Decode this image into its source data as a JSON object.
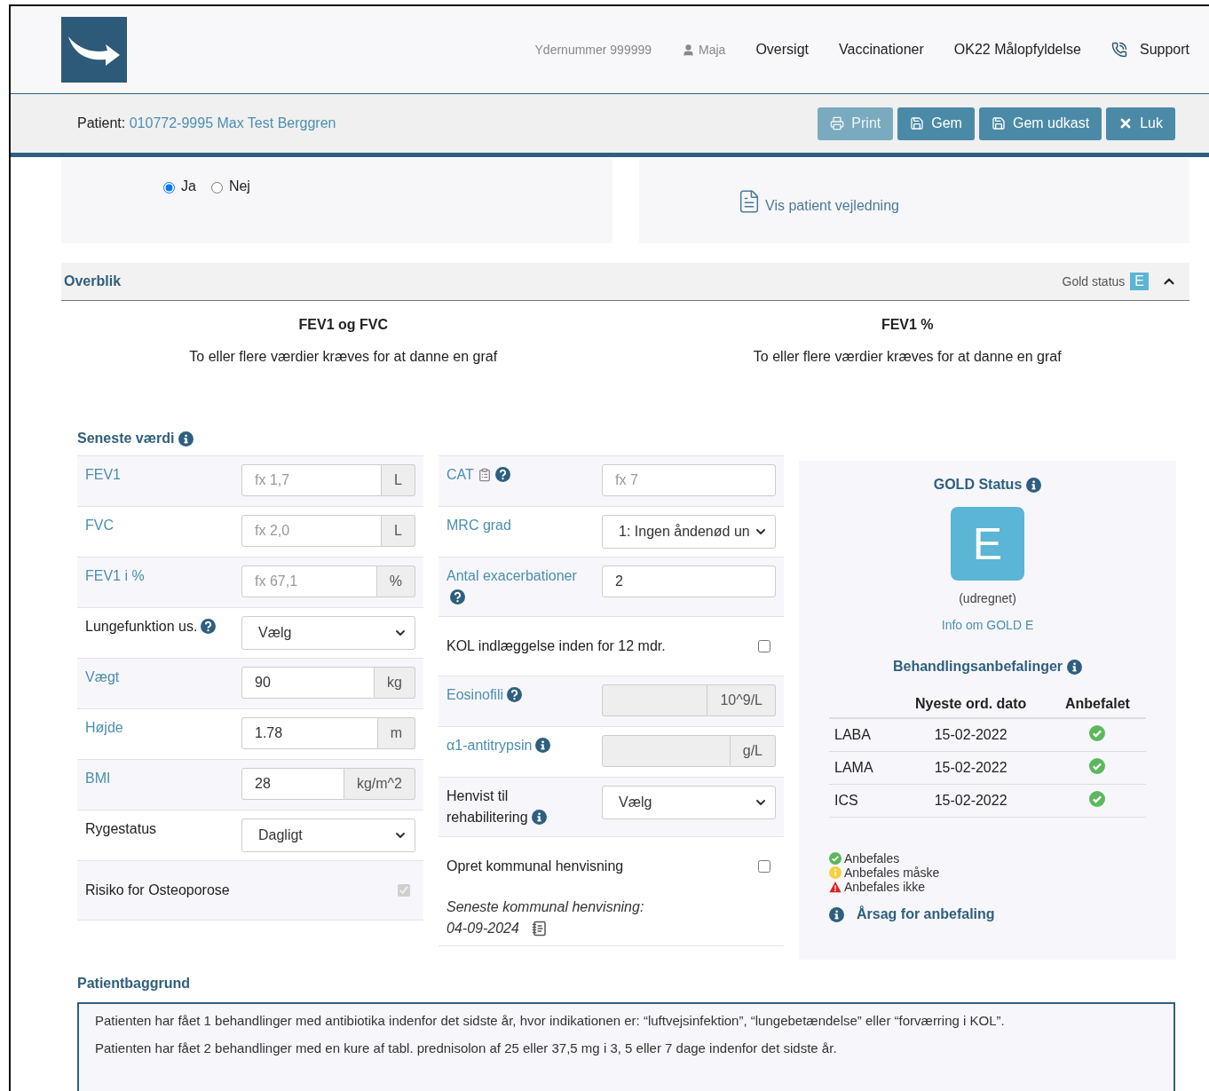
{
  "header": {
    "provider_number": "Ydernummer 999999",
    "user": "Maja",
    "nav": [
      {
        "label": "Oversigt",
        "kind": "link"
      },
      {
        "label": "Vaccinationer",
        "kind": "link"
      },
      {
        "label": "OK22 Målopfyldelse",
        "kind": "link"
      },
      {
        "label": "Support",
        "kind": "support"
      }
    ]
  },
  "patient_bar": {
    "label": "Patient:",
    "patient": "010772-9995 Max Test Berggren",
    "buttons": [
      {
        "label": "Print",
        "kind": "print",
        "disabled": true
      },
      {
        "label": "Gem",
        "kind": "save",
        "disabled": false
      },
      {
        "label": "Gem udkast",
        "kind": "save",
        "disabled": false
      },
      {
        "label": "Luk",
        "kind": "close",
        "disabled": false
      }
    ]
  },
  "consent": {
    "options": [
      {
        "label": "Ja",
        "selected": true
      },
      {
        "label": "Nej",
        "selected": false
      }
    ]
  },
  "guide_link": "Vis patient vejledning",
  "overview": {
    "title": "Overblik",
    "gold_label": "Gold status",
    "gold_value": "E",
    "expanded": true
  },
  "charts": [
    {
      "title": "FEV1 og FVC",
      "message": "To eller flere værdier kræves for at danne en graf"
    },
    {
      "title": "FEV1 %",
      "message": "To eller flere værdier kræves for at danne en graf"
    }
  ],
  "latest": {
    "title": "Seneste værdi",
    "columns": [
      [
        {
          "kind": "input",
          "label": "FEV1",
          "linked": true,
          "placeholder": "fx 1,7",
          "unit": "L",
          "disabled": false
        },
        {
          "kind": "input",
          "label": "FVC",
          "linked": true,
          "placeholder": "fx 2,0",
          "unit": "L",
          "disabled": false
        },
        {
          "kind": "input",
          "label": "FEV1 i %",
          "linked": true,
          "placeholder": "fx 67,1",
          "unit": "%",
          "disabled": false
        },
        {
          "kind": "select",
          "label": "Lungefunktion us.",
          "linked": false,
          "help_icon": true,
          "value": "Vælg"
        },
        {
          "kind": "input",
          "label": "Vægt",
          "linked": true,
          "value": "90",
          "unit": "kg",
          "disabled": false
        },
        {
          "kind": "input",
          "label": "Højde",
          "linked": true,
          "value": "1.78",
          "unit": "m",
          "disabled": false
        },
        {
          "kind": "input",
          "label": "BMI",
          "linked": true,
          "value": "28",
          "unit": "kg/m^2",
          "disabled": false
        },
        {
          "kind": "select",
          "label": "Rygestatus",
          "linked": false,
          "value": "Dagligt"
        },
        {
          "kind": "checkbox",
          "label": "Risiko for Osteoporose",
          "linked": false,
          "checked": true,
          "disabled": true
        }
      ],
      [
        {
          "kind": "input",
          "label": "CAT",
          "linked": true,
          "form_icon": true,
          "help_icon": true,
          "placeholder": "fx 7",
          "disabled": false
        },
        {
          "kind": "select",
          "label": "MRC grad",
          "linked": true,
          "value": "1: Ingen åndenød un"
        },
        {
          "kind": "input",
          "label": "Antal exacerbationer",
          "linked": true,
          "help_icon": true,
          "value": "2",
          "disabled": false
        },
        {
          "kind": "checkbox",
          "label": "KOL indlæggelse inden for 12 mdr.",
          "linked": false,
          "checked": false,
          "disabled": false
        },
        {
          "kind": "input",
          "label": "Eosinofili",
          "linked": true,
          "help_icon": true,
          "unit": "10^9/L",
          "disabled": true
        },
        {
          "kind": "input",
          "label": "α1-antitrypsin",
          "linked": true,
          "info_icon": true,
          "unit": "g/L",
          "disabled": true
        },
        {
          "kind": "select",
          "label": "Henvist til rehabilitering",
          "linked": false,
          "info_icon": true,
          "value": "Vælg"
        },
        {
          "kind": "checkbox",
          "label": "Opret kommunal henvisning",
          "linked": false,
          "checked": false,
          "disabled": false,
          "note": "Seneste kommunal henvisning:",
          "note_date": "04-09-2024"
        }
      ]
    ]
  },
  "gold": {
    "title": "GOLD Status",
    "grade": "E",
    "grade_note": "(udregnet)",
    "info_link": "Info om GOLD E",
    "recommendations": {
      "title": "Behandlingsanbefalinger",
      "columns": [
        "Nyeste ord. dato",
        "Anbefalet"
      ],
      "rows": [
        {
          "name": "LABA",
          "date": "15-02-2022",
          "kind": "yes"
        },
        {
          "name": "LAMA",
          "date": "15-02-2022",
          "kind": "yes"
        },
        {
          "name": "ICS",
          "date": "15-02-2022",
          "kind": "yes"
        }
      ]
    },
    "legend": [
      {
        "kind": "yes",
        "label": "Anbefales"
      },
      {
        "kind": "maybe",
        "label": "Anbefales måske"
      },
      {
        "kind": "no",
        "label": "Anbefales ikke"
      }
    ],
    "reason_link": "Årsag for anbefaling"
  },
  "background": {
    "title": "Patientbaggrund",
    "lines": [
      "Patienten har fået 1 behandlinger med antibiotika indenfor det sidste år, hvor indikationen er: “luftvejsinfektion”, “lungebetændelse” eller “forværring i KOL”.",
      "Patienten har fået 2 behandlinger med en kure af tabl. prednisolon af 25 eller 37,5 mg i 3, 5 eller 7 dage indenfor det sidste år."
    ]
  }
}
